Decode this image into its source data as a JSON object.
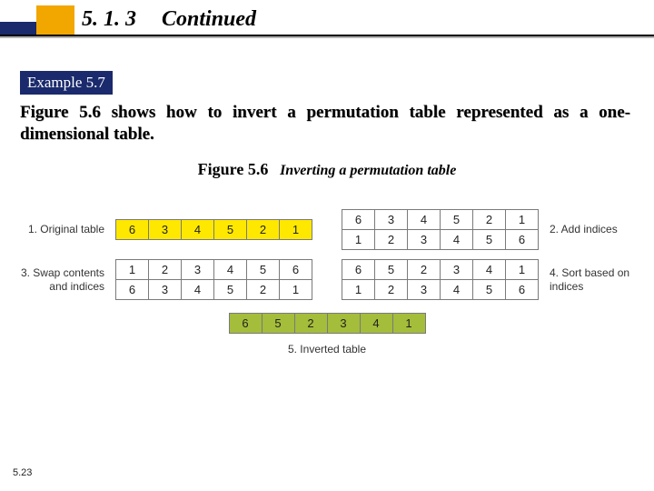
{
  "header": {
    "section_number": "5. 1. 3",
    "section_title": "Continued"
  },
  "example_label": "Example 5.7",
  "body_text": "Figure 5.6 shows how to invert a permutation table represented as a one-dimensional table.",
  "figure_caption": {
    "lead": "Figure 5.6",
    "tail": "Inverting a permutation table"
  },
  "tables": {
    "step1": {
      "label": "1. Original table",
      "values": [
        "6",
        "3",
        "4",
        "5",
        "2",
        "1"
      ]
    },
    "step2": {
      "label": "2. Add indices",
      "top": [
        "6",
        "3",
        "4",
        "5",
        "2",
        "1"
      ],
      "bottom": [
        "1",
        "2",
        "3",
        "4",
        "5",
        "6"
      ]
    },
    "step3": {
      "label": "3. Swap contents and indices",
      "top": [
        "1",
        "2",
        "3",
        "4",
        "5",
        "6"
      ],
      "bottom": [
        "6",
        "3",
        "4",
        "5",
        "2",
        "1"
      ]
    },
    "step4": {
      "label": "4. Sort based on indices",
      "top": [
        "6",
        "5",
        "2",
        "3",
        "4",
        "1"
      ],
      "bottom": [
        "1",
        "2",
        "3",
        "4",
        "5",
        "6"
      ]
    },
    "step5": {
      "label": "5. Inverted table",
      "values": [
        "6",
        "5",
        "2",
        "3",
        "4",
        "1"
      ]
    }
  },
  "page_number": "5.23"
}
